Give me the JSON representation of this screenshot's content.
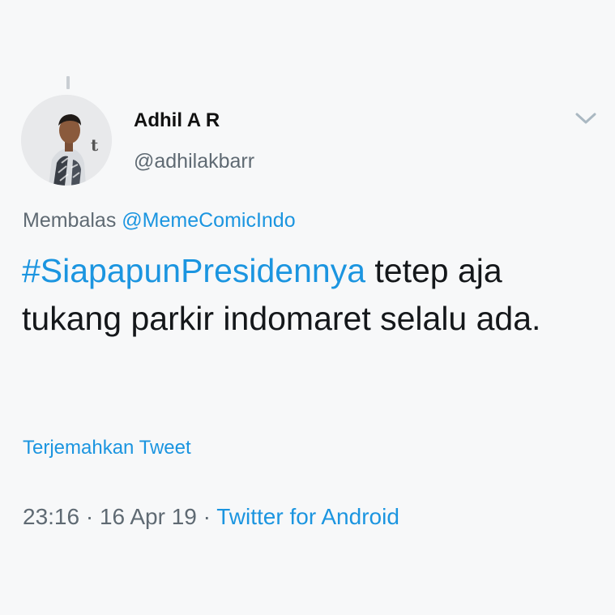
{
  "tweet": {
    "author": {
      "name": "Adhil A R",
      "handle": "@adhilakbarr",
      "avatar_letter": "t"
    },
    "reply_to": {
      "prefix": "Membalas",
      "mention": "@MemeComicIndo"
    },
    "text": {
      "hashtag": "#SiapapunPresidennya",
      "body": "tetep aja tukang parkir indomaret selalu ada."
    },
    "translate_label": "Terjemahkan Tweet",
    "meta": {
      "time": "23:16",
      "separator": "·",
      "date": "16 Apr 19",
      "source": "Twitter for Android"
    },
    "menu_icon": "chevron-down-icon"
  },
  "colors": {
    "background": "#f7f8f9",
    "link": "#1b95e0",
    "secondary_text": "#5f6a73",
    "primary_text": "#14171a"
  }
}
